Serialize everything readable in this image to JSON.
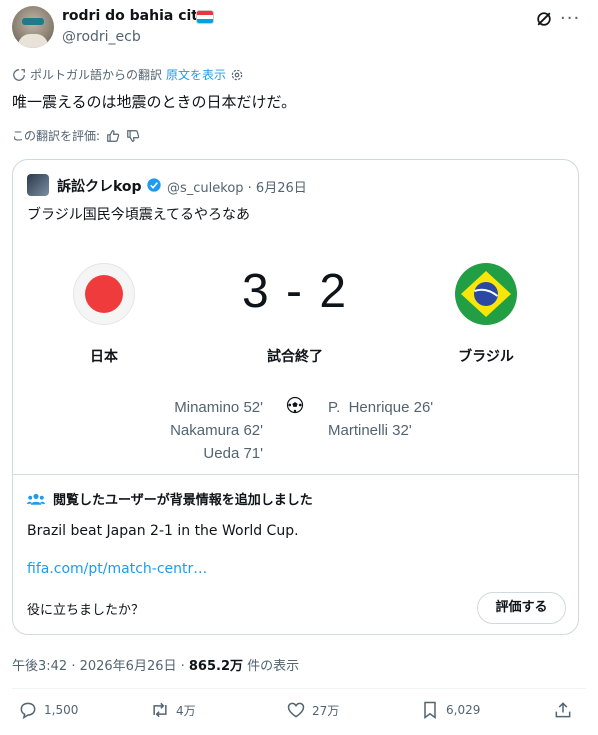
{
  "author": {
    "name": "rodri do bahia city",
    "handle": "@rodri_ecb"
  },
  "translation": {
    "notice": "ポルトガル語からの翻訳",
    "show_original": "原文を表示",
    "rate_prompt": "この翻訳を評価:"
  },
  "tweet": {
    "text": "唯一震えるのは地震のときの日本だけだ。"
  },
  "quote": {
    "name": "訴訟クレkop",
    "handle_date": "@s_culekop · 6月26日",
    "text": "ブラジル国民今頃震えてるやろなあ",
    "match": {
      "score": "3 - 2",
      "status": "試合終了",
      "home_team": "日本",
      "away_team": "ブラジル",
      "home_scorers": [
        "Minamino 52'",
        "Nakamura 62'",
        "Ueda 71'"
      ],
      "away_scorers": [
        "P.  Henrique 26'",
        "Martinelli 32'"
      ]
    }
  },
  "community_note": {
    "header": "閲覧したユーザーが背景情報を追加しました",
    "body": "Brazil beat Japan 2-1 in the World Cup.",
    "link": "fifa.com/pt/match-centr…",
    "question": "役に立ちましたか？",
    "rate_button": "評価する"
  },
  "meta": {
    "time": "午後3:42 · 2026年6月26日 · ",
    "views": "865.2万",
    "views_label": " 件の表示"
  },
  "actions": {
    "replies": "1,500",
    "reposts": "4万",
    "likes": "27万",
    "bookmarks": "6,029"
  },
  "colors": {
    "accent": "#1d9bf0",
    "secondary_text": "#536471",
    "border": "#cfd9de"
  },
  "icons": [
    "grok-icon",
    "more-icon",
    "translate-gear-icon",
    "thumbs-up-icon",
    "thumbs-down-icon",
    "verified-icon",
    "soccer-ball-icon",
    "users-icon",
    "reply-icon",
    "repost-icon",
    "like-icon",
    "bookmark-icon",
    "share-icon"
  ]
}
